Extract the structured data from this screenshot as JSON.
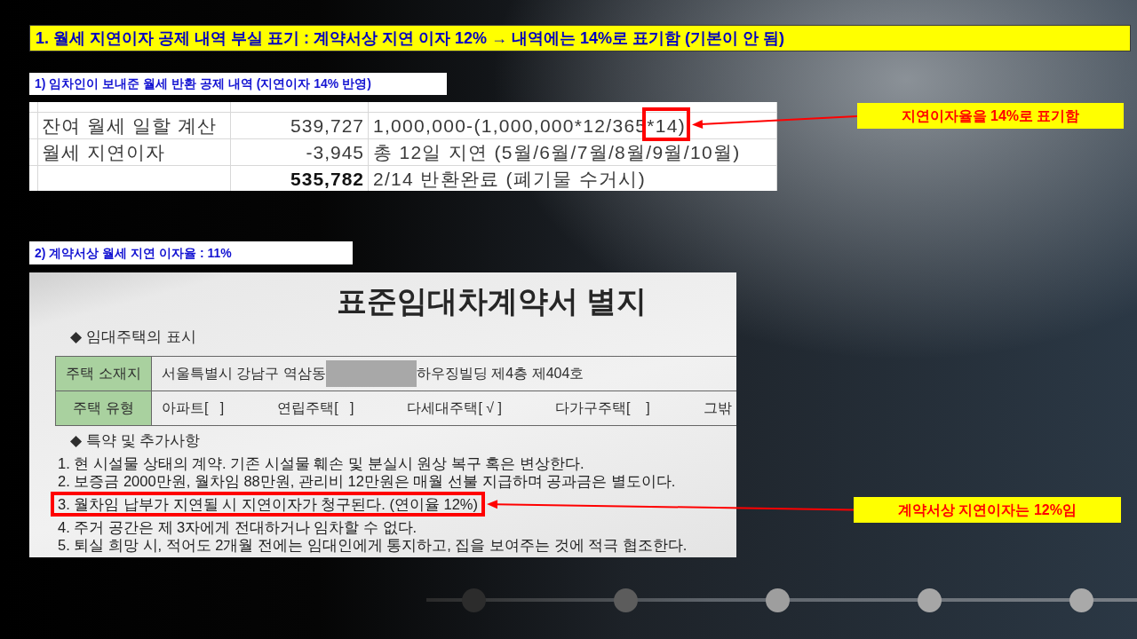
{
  "title_bar": {
    "text": "1. 월세 지연이자 공제 내역 부실 표기 : 계약서상 지연 이자 12% → 내역에는 14%로 표기함 (기본이 안 됨)"
  },
  "section_1": {
    "heading": "1) 임차인이 보내준 월세 반환 공제 내역 (지연이자 14% 반영)",
    "sheet": {
      "rows": [
        {
          "label": "잔여 월세 일할 계산",
          "amount": "539,727",
          "note": "1,000,000-(1,000,000*12/365",
          "note_end": "*14)",
          "marked": true,
          "total": false
        },
        {
          "label": "월세 지연이자",
          "amount": "-3,945",
          "note": "총 12일 지연 (5월/6월/7월/8월/9월/10월)",
          "marked": false,
          "total": false
        },
        {
          "amount": "535,782",
          "note": "2/14 반환완료 (폐기물 수거시)",
          "marked": false,
          "total": true
        }
      ]
    },
    "callout": "지연이자율을 14%로 표기함"
  },
  "section_2": {
    "heading": "2) 계약서상 월세 지연 이자율 : 11%",
    "document": {
      "title": "표준임대차계약서 별지",
      "heading_1": "◆ 임대주택의 표시",
      "table": [
        {
          "label": "주택 소재지",
          "kind": "address",
          "parts": [
            "서울특별시 강남구 역삼동",
            "하우징빌딩 제4층 제404호"
          ],
          "redacted": true
        },
        {
          "label": "주택 유형",
          "kind": "options",
          "options": [
            "아파트[   ]",
            "연립주택[   ]",
            "다세대주택[ √ ]",
            "다가구주택[    ]",
            "그밖"
          ]
        }
      ],
      "heading_2": "◆ 특약 및 추가사항",
      "clauses": [
        {
          "text": "1. 현 시설물 상태의 계약. 기존 시설물 훼손 및 분실시 원상 복구 혹은 변상한다.",
          "marked": false
        },
        {
          "text": "2. 보증금 2000만원, 월차임 88만원, 관리비 12만원은 매월 선불 지급하며 공과금은 별도이다.",
          "marked": false
        },
        {
          "text": "3. 월차임 납부가 지연될 시 지연이자가 청구된다. (연이율 12%)",
          "marked": true
        },
        {
          "text": "4. 주거 공간은 제 3자에게 전대하거나 임차할 수 없다.",
          "marked": false
        },
        {
          "text": "5. 퇴실 희망 시, 적어도 2개월 전에는 임대인에게 통지하고, 집을 보여주는 것에 적극 협조한다.",
          "marked": false
        }
      ]
    },
    "callout": "계약서상 지연이자는 12%임"
  }
}
